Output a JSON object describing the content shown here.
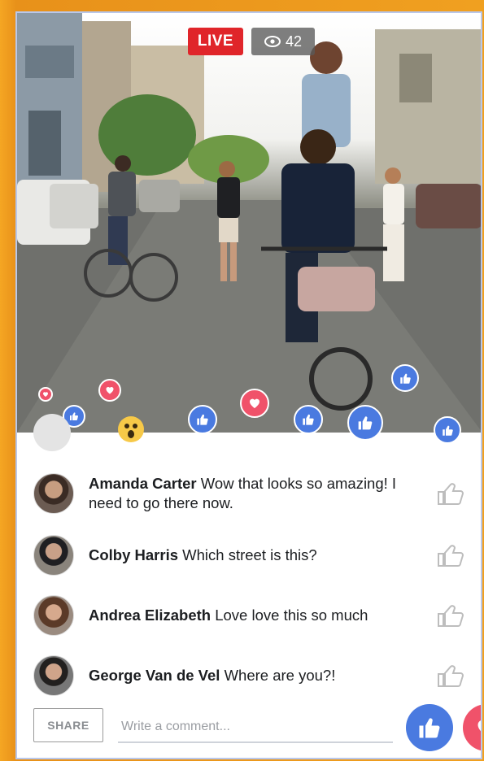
{
  "live": {
    "badge_label": "LIVE",
    "viewer_count": "42"
  },
  "comments": [
    {
      "name": "Amanda Carter",
      "text": "Wow that looks so amazing! I need to go there now."
    },
    {
      "name": "Colby Harris",
      "text": "Which street is this?"
    },
    {
      "name": "Andrea Elizabeth",
      "text": "Love love this so much"
    },
    {
      "name": "George Van de Vel",
      "text": "Where are you?!"
    }
  ],
  "composer": {
    "share_label": "SHARE",
    "placeholder": "Write a comment..."
  },
  "icons": {
    "viewers": "eye-icon",
    "comment_like": "thumbs-up-outline-icon",
    "like_button": "thumbs-up-icon",
    "love_button": "heart-icon"
  },
  "colors": {
    "live_red": "#e0252a",
    "like_blue": "#4a7ae0",
    "love_red": "#f0526a",
    "frame_border": "#b9c7ea"
  }
}
